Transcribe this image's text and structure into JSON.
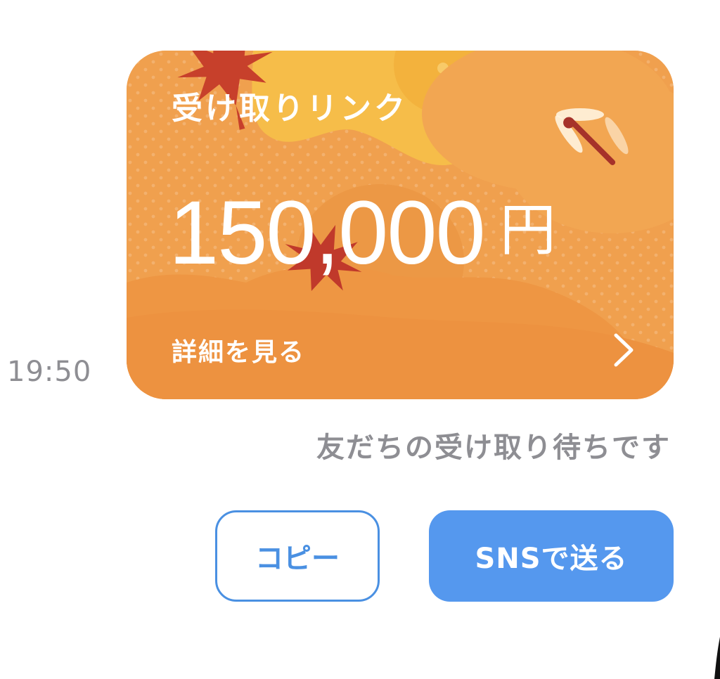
{
  "message": {
    "timestamp": "19:50",
    "card": {
      "title": "受け取りリンク",
      "amount": "150,000",
      "currency": "円",
      "details_label": "詳細を見る",
      "theme": "autumn-maple-dragonfly",
      "colors": {
        "base": "#f0a04e",
        "sky": "#f7c04a",
        "accent": "#c0392b"
      }
    },
    "status": "友だちの受け取り待ちです"
  },
  "actions": {
    "copy_label": "コピー",
    "sns_label": "SNSで送る",
    "primary_color": "#5598ee"
  }
}
